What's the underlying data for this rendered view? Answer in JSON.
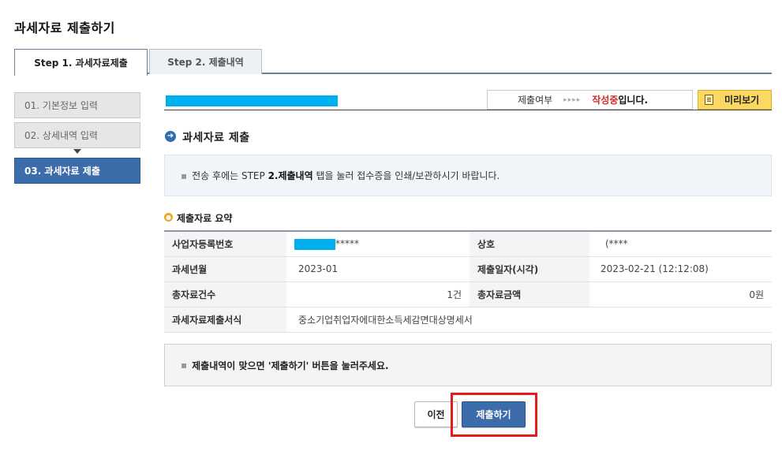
{
  "page": {
    "title": "과세자료 제출하기"
  },
  "tabs": [
    {
      "label": "Step 1. 과세자료제출",
      "active": true
    },
    {
      "label": "Step 2. 제출내역",
      "active": false
    }
  ],
  "steps": [
    {
      "label": "01. 기본정보 입력",
      "state": "done"
    },
    {
      "label": "02. 상세내역 입력",
      "state": "done"
    },
    {
      "label": "03. 과세자료 제출",
      "state": "current"
    }
  ],
  "status": {
    "label": "제출여부",
    "arrows": "▸▸▸▸",
    "value": "작성중",
    "suffix": "입니다."
  },
  "preview_button": {
    "label": "미리보기",
    "icon": "document-icon"
  },
  "section": {
    "title": "과세자료 제출",
    "icon": "arrow-circle-icon"
  },
  "info": {
    "bullet": "▪",
    "text_before": "전송 후에는 STEP ",
    "text_bold": "2.제출내역",
    "text_after": " 탭을 눌러 접수증을 인쇄/보관하시기 바랍니다."
  },
  "summary": {
    "title": "제출자료 요약",
    "rows": [
      {
        "h1": "사업자등록번호",
        "v1": "*****",
        "h2": "상호",
        "v2": "(****"
      },
      {
        "h1": "과세년월",
        "v1": "2023-01",
        "h2": "제출일자(시각)",
        "v2": "2023-02-21 (12:12:08)"
      },
      {
        "h1": "총자료건수",
        "v1": "1건",
        "h2": "총자료금액",
        "v2": "0원"
      },
      {
        "h1": "과세자료제출서식",
        "v1": "중소기업취업자에대한소득세감면대상명세서"
      }
    ]
  },
  "notice": {
    "bullet": "▪",
    "text": "제출내역이 맞으면 '제출하기' 버튼을 눌러주세요."
  },
  "buttons": {
    "prev": "이전",
    "submit": "제출하기"
  },
  "colors": {
    "accent": "#3d6cab",
    "status": "#d42b2b",
    "mask": "#00b0ee",
    "highlight": "#e21b1b"
  }
}
